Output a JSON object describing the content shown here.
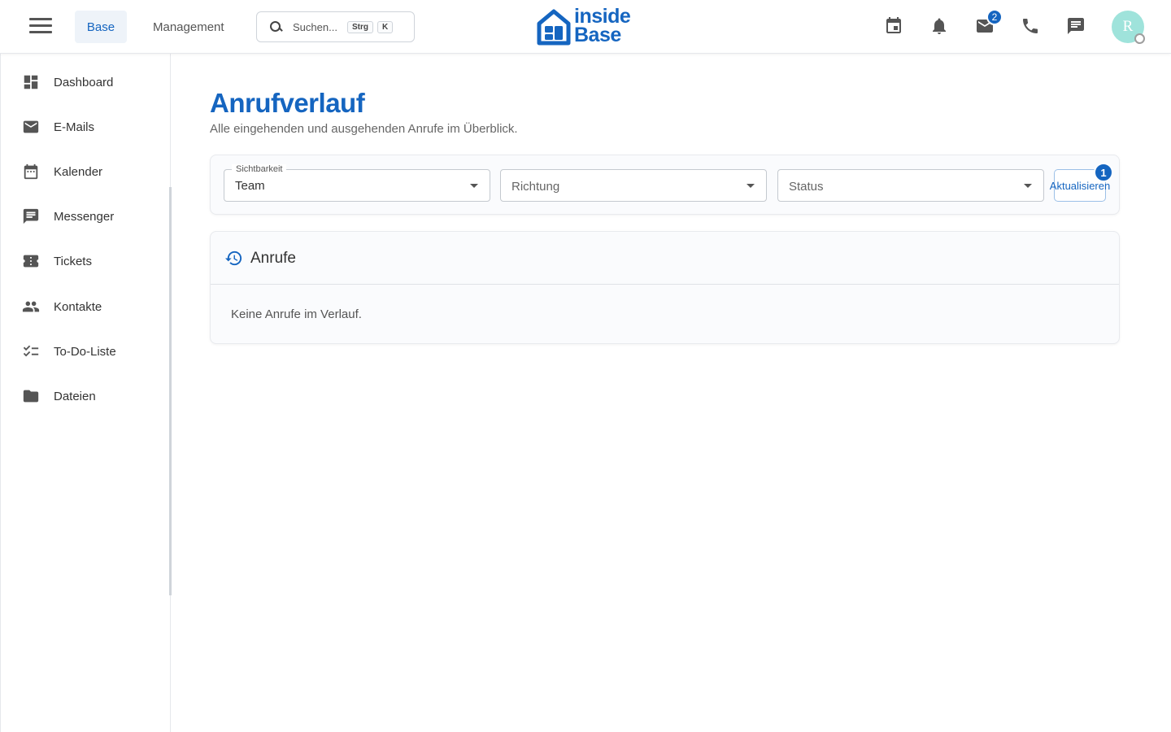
{
  "header": {
    "nav": {
      "base": "Base",
      "management": "Management"
    },
    "search": {
      "placeholder": "Suchen...",
      "kbd1": "Strg",
      "kbd2": "K"
    },
    "logo": {
      "line1": "inside",
      "line2": "Base"
    },
    "mail_badge": "2",
    "avatar_initial": "R",
    "icons": [
      "calendar-icon",
      "bell-icon",
      "mail-icon",
      "phone-icon",
      "chat-icon"
    ]
  },
  "sidebar": {
    "items": [
      {
        "label": "Dashboard",
        "icon": "dashboard-icon"
      },
      {
        "label": "E-Mails",
        "icon": "mail-icon"
      },
      {
        "label": "Kalender",
        "icon": "calendar-icon"
      },
      {
        "label": "Messenger",
        "icon": "chat-icon"
      },
      {
        "label": "Tickets",
        "icon": "ticket-icon"
      },
      {
        "label": "Kontakte",
        "icon": "contacts-icon"
      },
      {
        "label": "To-Do-Liste",
        "icon": "checklist-icon"
      },
      {
        "label": "Dateien",
        "icon": "folder-icon"
      }
    ]
  },
  "main": {
    "title": "Anrufverlauf",
    "subtitle": "Alle eingehenden und ausgehenden Anrufe im Überblick.",
    "filters": {
      "visibility": {
        "legend": "Sichtbarkeit",
        "value": "Team"
      },
      "direction": {
        "placeholder": "Richtung"
      },
      "status": {
        "placeholder": "Status"
      },
      "refresh_label": "Aktualisieren",
      "refresh_badge": "1"
    },
    "calls": {
      "title": "Anrufe",
      "empty": "Keine Anrufe im Verlauf."
    }
  },
  "colors": {
    "accent": "#1565c0",
    "avatar": "#9fe3db"
  }
}
